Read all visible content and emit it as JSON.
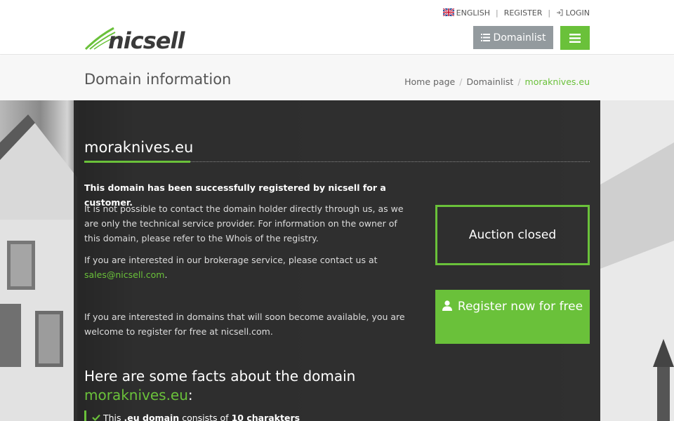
{
  "header": {
    "language": "ENGLISH",
    "register": "REGISTER",
    "login": "LOGIN",
    "logo_text": "nicsell",
    "domainlist_button": "Domainlist",
    "brand_color": "#6ac13a"
  },
  "titlebar": {
    "title": "Domain information",
    "breadcrumb": [
      "Home page",
      "Domainlist",
      "moraknives.eu"
    ]
  },
  "main": {
    "domain": "moraknives.eu",
    "registered_notice": "This domain has been successfully registered by nicsell for a customer.",
    "contact_text": "It is not possible to contact the domain holder directly through us, as we are only the technical service provider. For information on the owner of this domain, please refer to the Whois of the registry.",
    "brokerage_text": "If you are interested in our brokerage service, please contact us at",
    "brokerage_email": "sales@nicsell.com",
    "brokerage_end": ".",
    "soon_text": "If you are interested in domains that will soon become available, you are welcome to register for free at nicsell.com.",
    "auction_status": "Auction closed",
    "register_button": "Register now for free",
    "facts_heading": "Here are some facts about the domain",
    "facts_domain": "moraknives.eu",
    "facts_colon": ":",
    "fact1_pre": "This",
    "fact1_ext": ".eu domain",
    "fact1_mid": "consists of",
    "fact1_count": "10 charakters"
  }
}
